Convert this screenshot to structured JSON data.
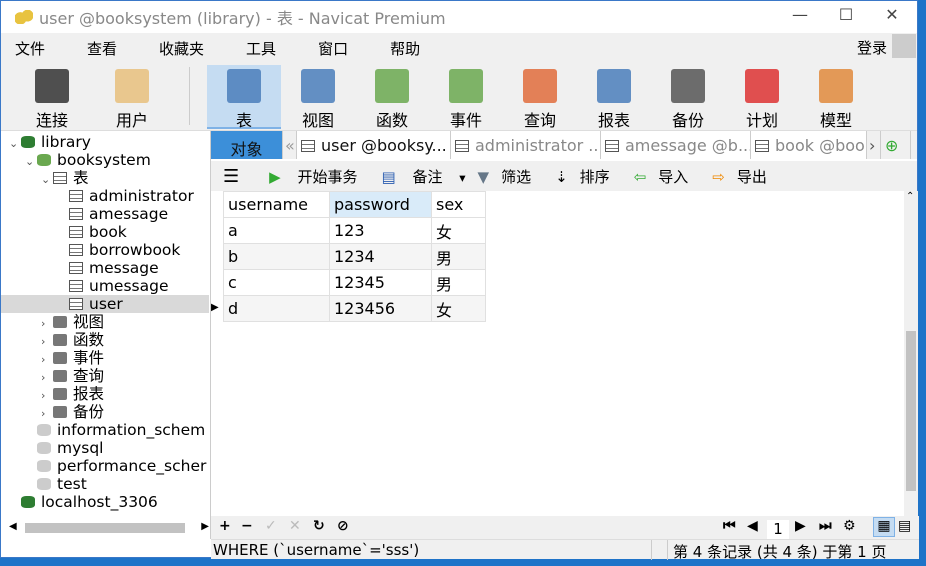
{
  "title": "user @booksystem (library) - 表 - Navicat Premium",
  "window_controls": {
    "minimize": "—",
    "maximize": "☐",
    "close": "✕"
  },
  "menu": [
    "文件",
    "查看",
    "收藏夹",
    "工具",
    "窗口",
    "帮助"
  ],
  "login": "登录",
  "toolbar": [
    {
      "label": "连接",
      "icon": "connection-icon",
      "color": "#333"
    },
    {
      "label": "用户",
      "icon": "user-icon",
      "color": "#e8c07d"
    },
    {
      "label": "表",
      "icon": "table-icon",
      "color": "#4a7ebb",
      "active": true
    },
    {
      "label": "视图",
      "icon": "view-icon",
      "color": "#4a7ebb"
    },
    {
      "label": "函数",
      "icon": "function-icon",
      "color": "#6aa84f"
    },
    {
      "label": "事件",
      "icon": "event-icon",
      "color": "#6aa84f"
    },
    {
      "label": "查询",
      "icon": "query-icon",
      "color": "#e06c3c"
    },
    {
      "label": "报表",
      "icon": "report-icon",
      "color": "#4a7ebb"
    },
    {
      "label": "备份",
      "icon": "backup-icon",
      "color": "#555"
    },
    {
      "label": "计划",
      "icon": "schedule-icon",
      "color": "#d33"
    },
    {
      "label": "模型",
      "icon": "model-icon",
      "color": "#e08a3c"
    }
  ],
  "tree": [
    {
      "label": "library",
      "level": 0,
      "icon": "connection",
      "arrow": "v"
    },
    {
      "label": "booksystem",
      "level": 1,
      "icon": "db",
      "arrow": "v"
    },
    {
      "label": "表",
      "level": 2,
      "icon": "table",
      "arrow": "v"
    },
    {
      "label": "administrator",
      "level": 3,
      "icon": "table"
    },
    {
      "label": "amessage",
      "level": 3,
      "icon": "table"
    },
    {
      "label": "book",
      "level": 3,
      "icon": "table"
    },
    {
      "label": "borrowbook",
      "level": 3,
      "icon": "table"
    },
    {
      "label": "message",
      "level": 3,
      "icon": "table"
    },
    {
      "label": "umessage",
      "level": 3,
      "icon": "table"
    },
    {
      "label": "user",
      "level": 3,
      "icon": "table",
      "selected": true
    },
    {
      "label": "视图",
      "level": 2,
      "icon": "view",
      "arrow": ">"
    },
    {
      "label": "函数",
      "level": 2,
      "icon": "function",
      "arrow": ">"
    },
    {
      "label": "事件",
      "level": 2,
      "icon": "event",
      "arrow": ">"
    },
    {
      "label": "查询",
      "level": 2,
      "icon": "query",
      "arrow": ">"
    },
    {
      "label": "报表",
      "level": 2,
      "icon": "report",
      "arrow": ">"
    },
    {
      "label": "备份",
      "level": 2,
      "icon": "backup",
      "arrow": ">"
    },
    {
      "label": "information_schem",
      "level": 1,
      "icon": "gdb"
    },
    {
      "label": "mysql",
      "level": 1,
      "icon": "gdb"
    },
    {
      "label": "performance_scher",
      "level": 1,
      "icon": "gdb"
    },
    {
      "label": "test",
      "level": 1,
      "icon": "gdb"
    },
    {
      "label": "localhost_3306",
      "level": 0,
      "icon": "connection"
    }
  ],
  "tabs": {
    "objects": "对象",
    "items": [
      "user @booksy...",
      "administrator ...",
      "amessage @b...",
      "book @boo"
    ]
  },
  "subtoolbar": {
    "begin_transaction": "开始事务",
    "memo": "备注",
    "filter": "筛选",
    "sort": "排序",
    "import": "导入",
    "export": "导出"
  },
  "table": {
    "columns": [
      "username",
      "password",
      "sex"
    ],
    "rows": [
      [
        "a",
        "123",
        "女"
      ],
      [
        "b",
        "1234",
        "男"
      ],
      [
        "c",
        "12345",
        "男"
      ],
      [
        "d",
        "123456",
        "女"
      ]
    ],
    "current_row": 3
  },
  "bottom": {
    "page": "1"
  },
  "status": {
    "sql": "WHERE (`username`='sss')",
    "records": "第 4 条记录 (共 4 条) 于第 1 页"
  }
}
